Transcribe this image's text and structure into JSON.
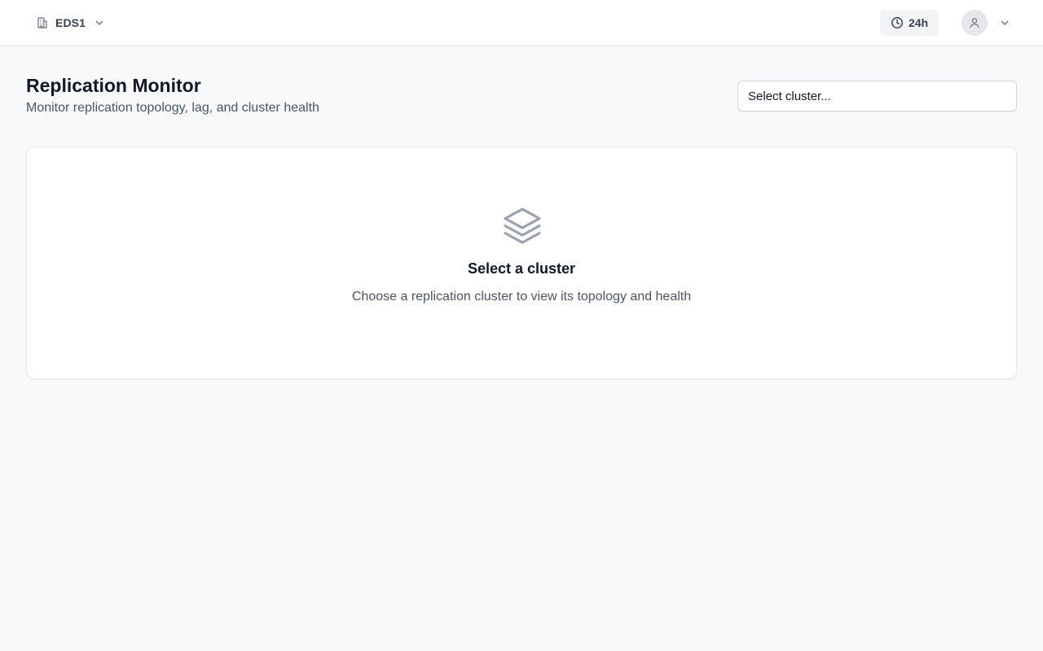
{
  "header": {
    "org": {
      "label": "EDS1",
      "icon": "building-icon"
    },
    "time_range": {
      "label": "24h",
      "icon": "clock-icon"
    },
    "user": {
      "icon": "user-icon"
    }
  },
  "page": {
    "title": "Replication Monitor",
    "subtitle": "Monitor replication topology, lag, and cluster health"
  },
  "cluster_select": {
    "placeholder": "Select cluster..."
  },
  "empty_state": {
    "icon": "layers-icon",
    "title": "Select a cluster",
    "description": "Choose a replication cluster to view its topology and health"
  },
  "colors": {
    "background": "#f8f9fb",
    "surface": "#ffffff",
    "border": "#e5e7eb",
    "text_primary": "#111827",
    "text_secondary": "#4b5563",
    "icon_muted": "#9ca3af"
  }
}
